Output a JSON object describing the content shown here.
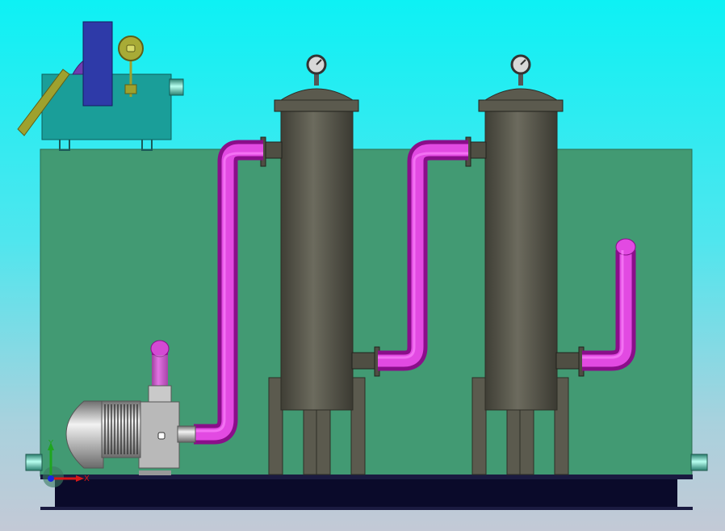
{
  "viewport": {
    "background_top": "#0df1f4",
    "background_bottom": "#c3c9d6"
  },
  "colors": {
    "tank": "#429a73",
    "pipe": "#c41ec4",
    "vessel": "#5b5a4e",
    "base": "#0a0a2a",
    "motor": "#b8b8b8",
    "dosing_unit": "#1a9e99",
    "dosing_motor": "#2e3aa8",
    "flow_meter": "#9ea12e"
  },
  "equipment": {
    "pump_motor": "pump-motor",
    "pump_body": "pump-body",
    "filter_1": "filter-vessel-1",
    "filter_2": "filter-vessel-2",
    "gauge_1": "pressure-gauge-1",
    "gauge_2": "pressure-gauge-2",
    "dosing": "dosing-unit",
    "tank": "water-tank"
  },
  "triad": {
    "x_label": "X",
    "y_label": "Y"
  }
}
